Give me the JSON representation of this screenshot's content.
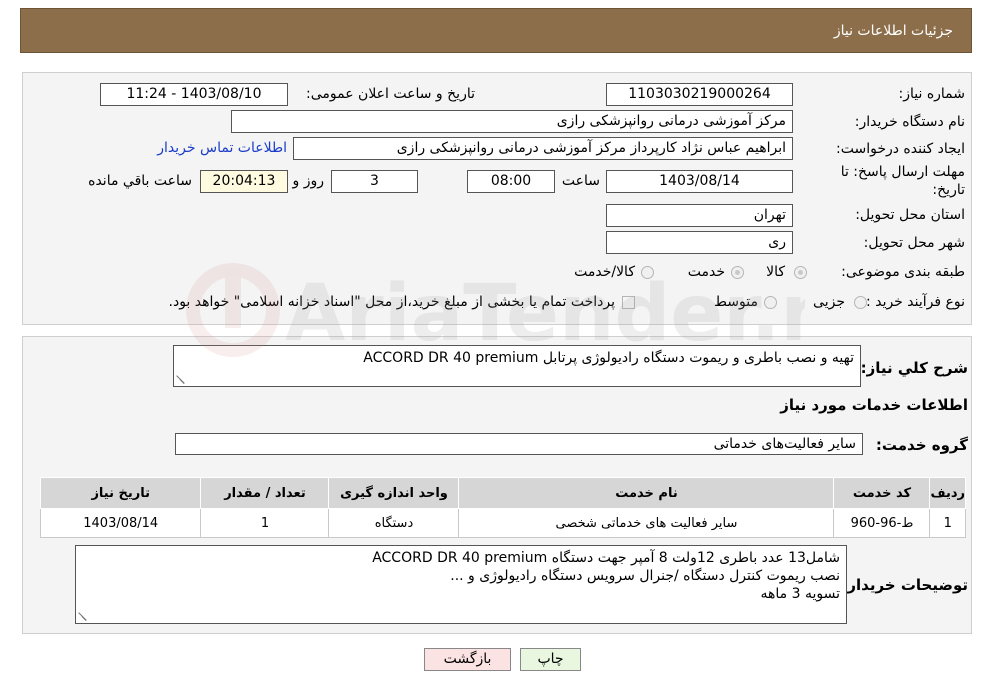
{
  "header": {
    "title": "جزئیات اطلاعات نیاز"
  },
  "form": {
    "need_number_label": "شماره نیاز:",
    "need_number": "1103030219000264",
    "announce_label": "تاریخ و ساعت اعلان عمومی:",
    "announce_value": "1403/08/10 - 11:24",
    "buyer_label": "نام دستگاه خریدار:",
    "buyer_value": "مرکز آموزشی درمانی روانپزشکی رازی",
    "creator_label": "ایجاد کننده درخواست:",
    "creator_value": "ابراهیم عباس نژاد کارپرداز مرکز آموزشی درمانی روانپزشکی رازی",
    "contact_link": "اطلاعات تماس خریدار",
    "deadline_label_1": "مهلت ارسال پاسخ: تا",
    "deadline_label_2": "تاریخ:",
    "deadline_date": "1403/08/14",
    "time_label": "ساعت",
    "deadline_time": "08:00",
    "days_value": "3",
    "days_label": "روز و",
    "remaining_time": "20:04:13",
    "remaining_label": "ساعت باقي مانده",
    "province_label": "استان محل تحویل:",
    "province_value": "تهران",
    "city_label": "شهر محل تحویل:",
    "city_value": "ری",
    "category_label": "طبقه بندی موضوعی:",
    "category_options": [
      "کالا",
      "خدمت",
      "کالا/خدمت"
    ],
    "process_label": "نوع فرآیند خرید :",
    "process_options": [
      "جزیی",
      "متوسط"
    ],
    "payment_note": "پرداخت تمام یا بخشی از مبلغ خرید،از محل \"اسناد خزانه اسلامی\" خواهد بود."
  },
  "details": {
    "summary_label": "شرح کلي نياز:",
    "summary_value": "تهیه و نصب باطری و ریموت دستگاه رادیولوژی پرتابل ACCORD DR 40 premium",
    "services_heading": "اطلاعات خدمات مورد نياز",
    "service_group_label": "گروه خدمت:",
    "service_group_value": "سایر فعالیت‌های خدماتی"
  },
  "table": {
    "headers": [
      "رديف",
      "کد خدمت",
      "نام خدمت",
      "واحد اندازه گيری",
      "تعداد / مقدار",
      "تاریخ نیاز"
    ],
    "rows": [
      [
        "1",
        "ط-96-960",
        "سایر فعالیت های خدماتی شخصی",
        "دستگاه",
        "1",
        "1403/08/14"
      ]
    ]
  },
  "buyer_notes": {
    "label": "توضيحات خريدار:",
    "lines": [
      "شامل13 عدد باطری 12ولت 8 آمپر جهت دستگاه ACCORD DR 40 premium",
      "نصب ریموت کنترل دستگاه /جنرال سرویس دستگاه رادیولوژی و ...",
      "تسویه 3 ماهه"
    ]
  },
  "buttons": {
    "print": "چاپ",
    "back": "بازگشت"
  },
  "watermark": {
    "text": "AriaTender.neT"
  },
  "colors": {
    "header_bg": "#8c6e4a",
    "link": "#1a3cc8",
    "print_btn": "#e9f7e1",
    "back_btn": "#fbe3e3"
  }
}
